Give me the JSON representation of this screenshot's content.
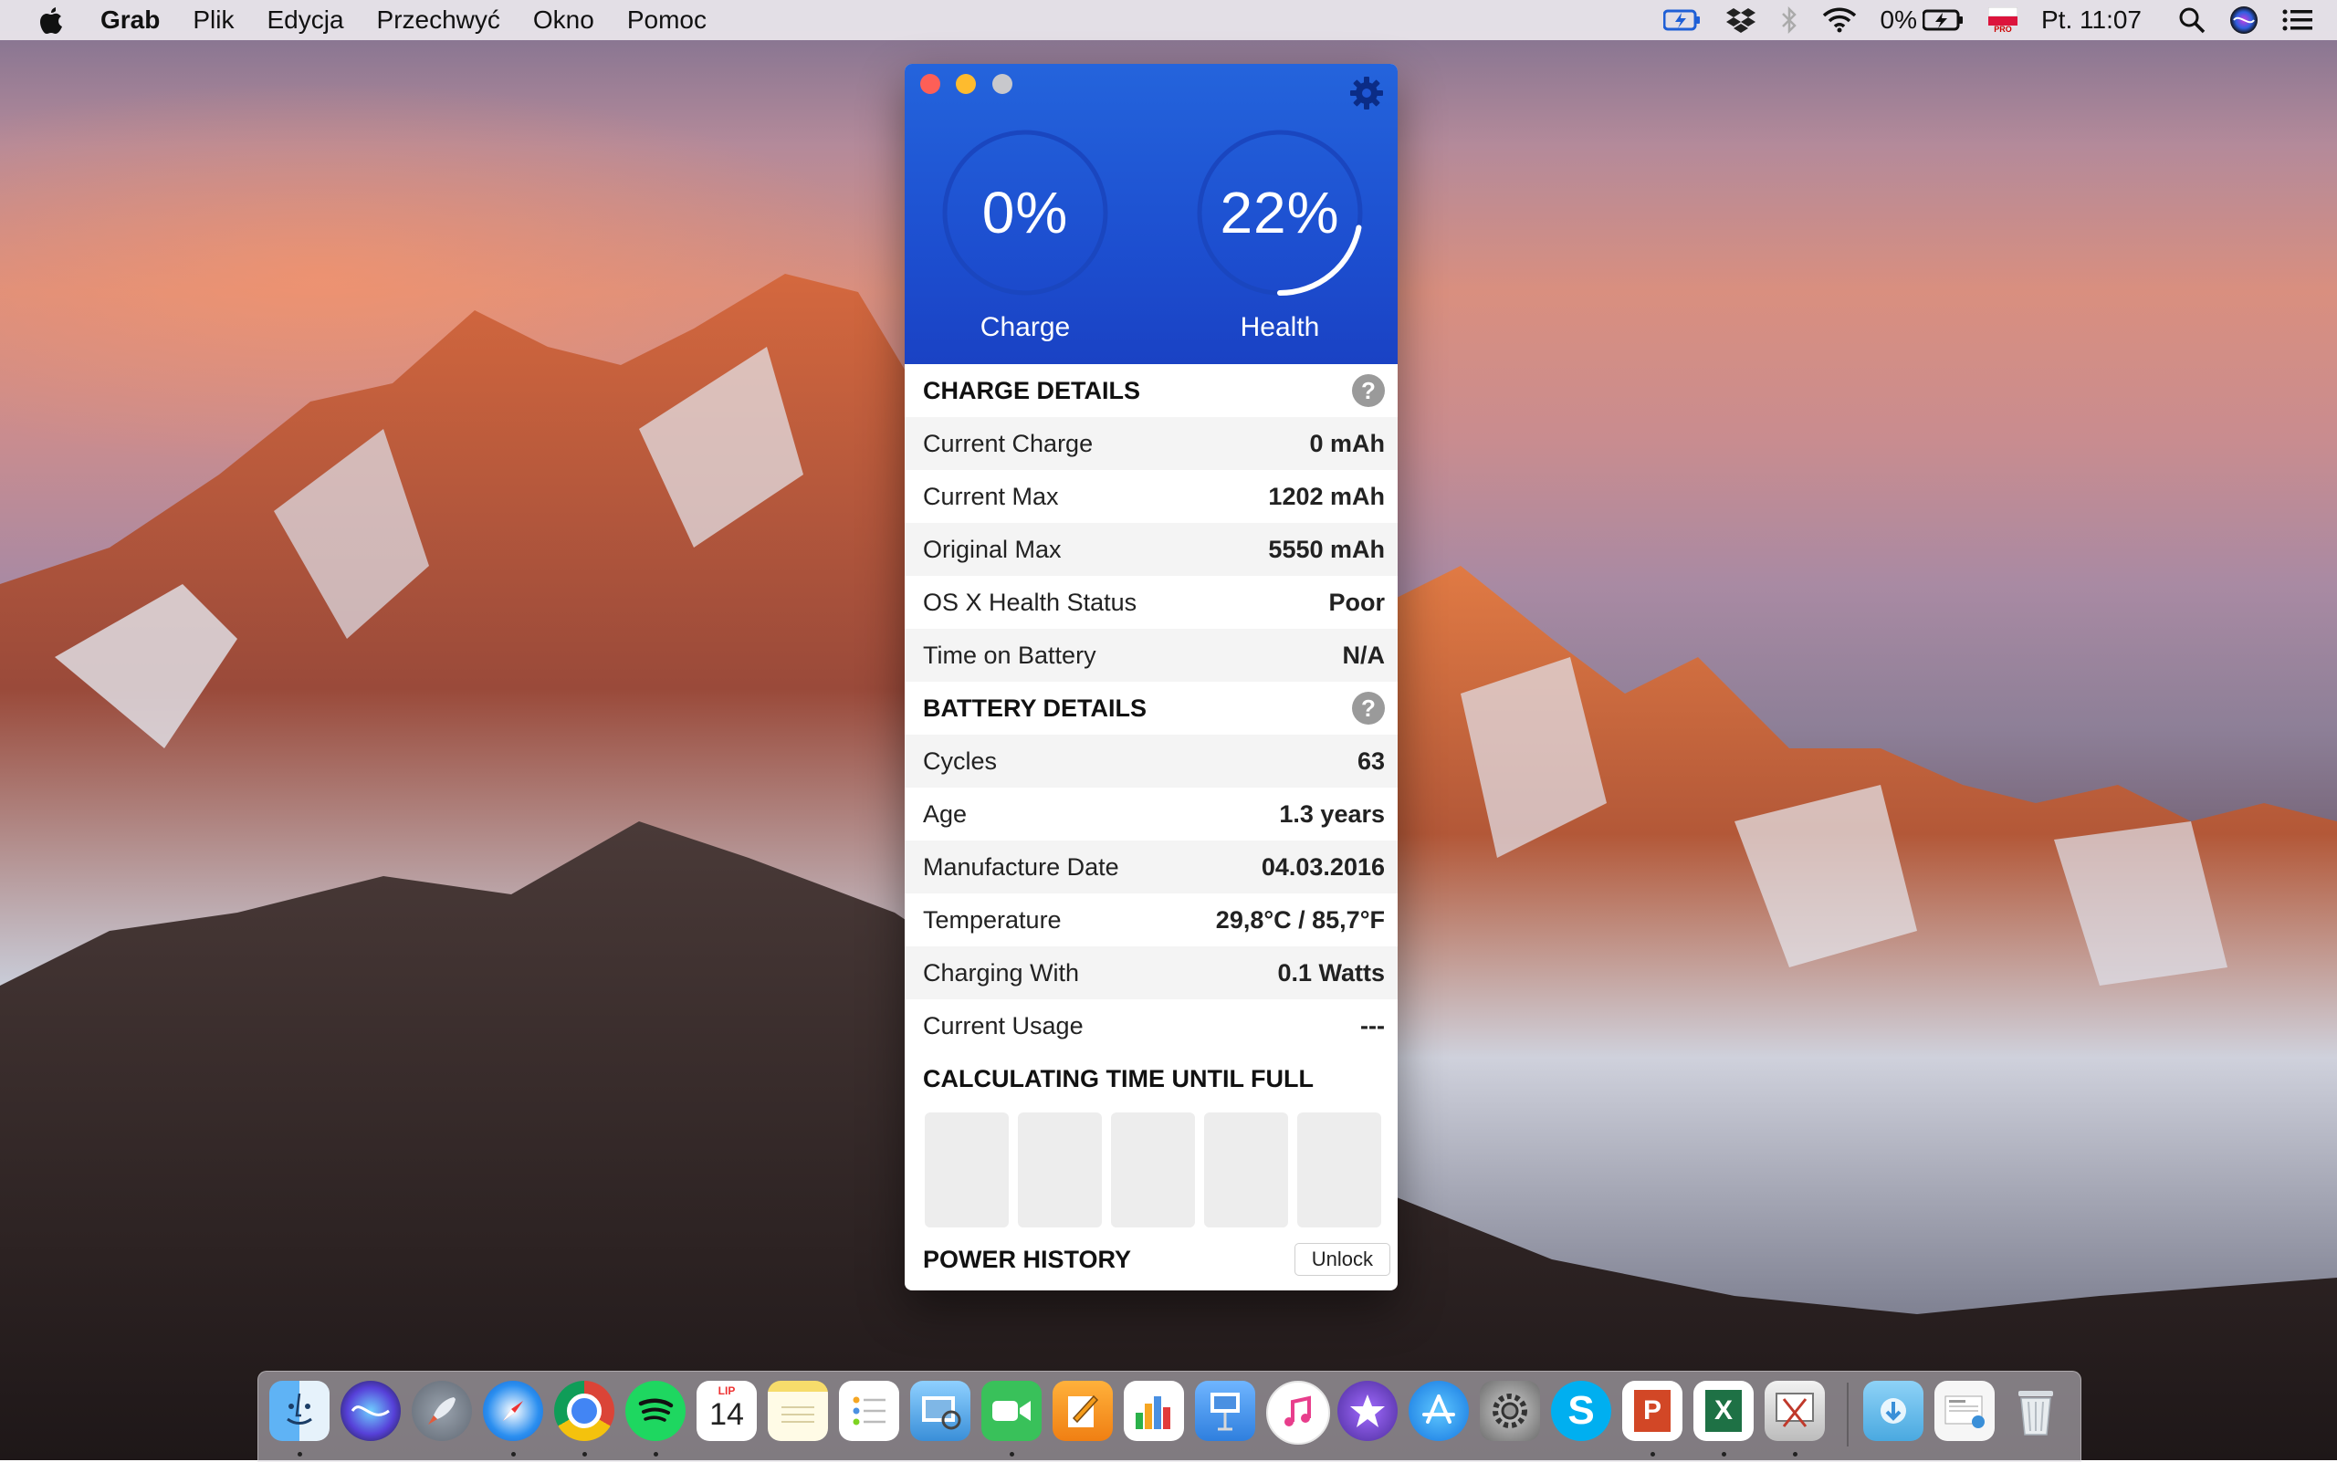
{
  "menubar": {
    "app_name": "Grab",
    "menus": [
      "Plik",
      "Edycja",
      "Przechwyć",
      "Okno",
      "Pomoc"
    ],
    "battery_percent": "0%",
    "clock": "Pt. 11:07",
    "flag_badge": "PRO"
  },
  "window": {
    "gauges": {
      "charge": {
        "value": "0%",
        "label": "Charge",
        "fraction": 0.0
      },
      "health": {
        "value": "22%",
        "label": "Health",
        "fraction": 0.22
      }
    },
    "charge_details": {
      "title": "CHARGE DETAILS",
      "help": "?",
      "rows": [
        {
          "label": "Current Charge",
          "value": "0 mAh"
        },
        {
          "label": "Current Max",
          "value": "1202 mAh"
        },
        {
          "label": "Original Max",
          "value": "5550 mAh"
        },
        {
          "label": "OS X Health Status",
          "value": "Poor"
        },
        {
          "label": "Time on Battery",
          "value": "N/A"
        }
      ]
    },
    "battery_details": {
      "title": "BATTERY DETAILS",
      "help": "?",
      "rows": [
        {
          "label": "Cycles",
          "value": "63"
        },
        {
          "label": "Age",
          "value": "1.3 years"
        },
        {
          "label": "Manufacture Date",
          "value": "04.03.2016"
        },
        {
          "label": "Temperature",
          "value": "29,8°C / 85,7°F"
        },
        {
          "label": "Charging With",
          "value": "0.1 Watts"
        },
        {
          "label": "Current Usage",
          "value": "---"
        }
      ]
    },
    "calculating_title": "CALCULATING TIME UNTIL FULL",
    "power_history_title": "POWER HISTORY",
    "unlock_label": "Unlock"
  },
  "dock": {
    "calendar_month": "LIP",
    "calendar_day": "14",
    "apps": [
      "finder",
      "siri",
      "launchpad",
      "safari",
      "chrome",
      "spotify",
      "calendar",
      "notes",
      "reminders",
      "preview",
      "facetime",
      "pages",
      "numbers",
      "keynote",
      "itunes",
      "imovie",
      "app-store",
      "system-preferences",
      "skype",
      "powerpoint",
      "excel",
      "grab",
      "downloads",
      "documents",
      "trash"
    ]
  }
}
